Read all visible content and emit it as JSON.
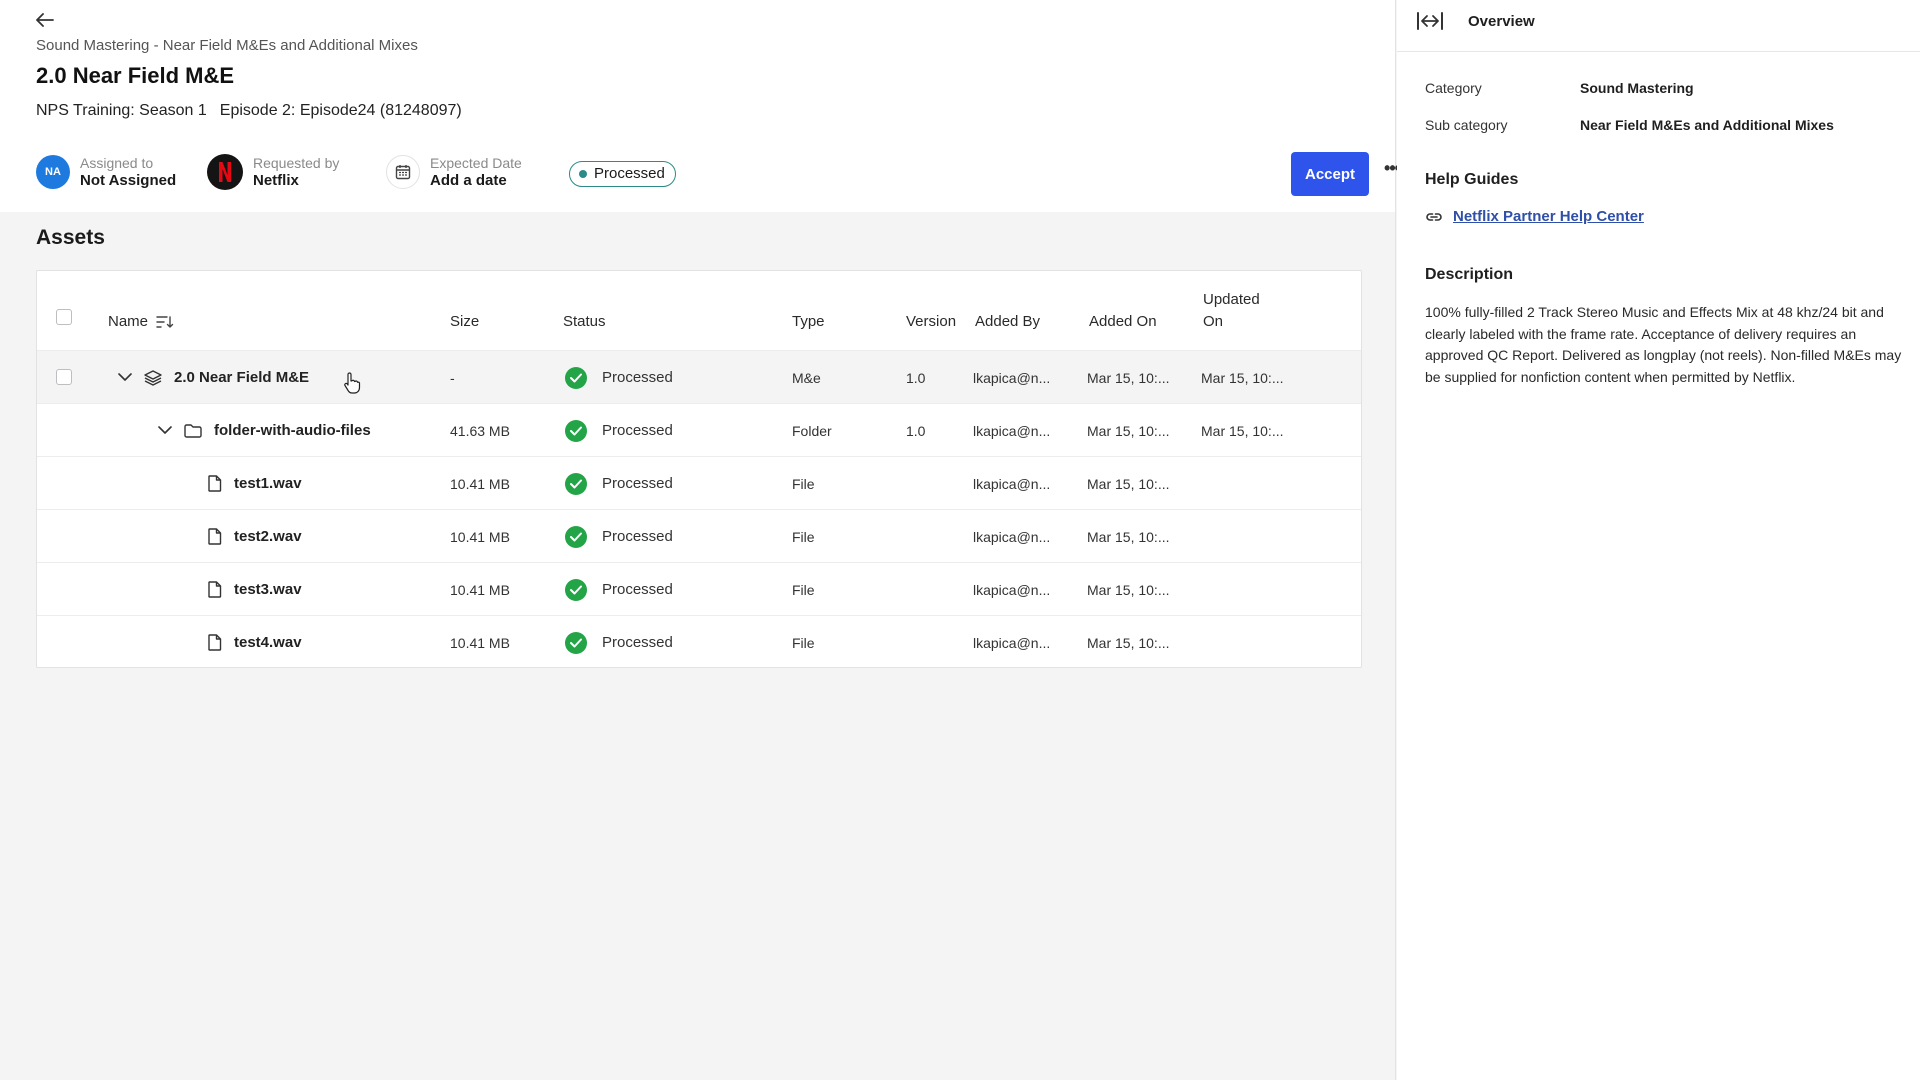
{
  "header": {
    "breadcrumb": "Sound Mastering - Near Field M&Es and Additional Mixes",
    "title": "2.0 Near Field M&E",
    "subtitle_season": "NPS Training: Season 1",
    "subtitle_episode": "Episode 2: Episode24 (81248097)",
    "assigned": {
      "initials": "NA",
      "label": "Assigned to",
      "value": "Not Assigned"
    },
    "requested": {
      "label": "Requested by",
      "value": "Netflix"
    },
    "expected": {
      "label": "Expected Date",
      "value": "Add a date"
    },
    "status": "Processed",
    "accept_label": "Accept",
    "more_label": "•••"
  },
  "assets": {
    "title": "Assets",
    "columns": {
      "name": "Name",
      "size": "Size",
      "status": "Status",
      "type": "Type",
      "version": "Version",
      "added_by": "Added By",
      "added_on": "Added On",
      "updated_on_1": "Updated",
      "updated_on_2": "On"
    },
    "rows": [
      {
        "name": "2.0 Near Field M&E",
        "size": "-",
        "status": "Processed",
        "type": "M&e",
        "version": "1.0",
        "added_by": "lkapica@n...",
        "added_on": "Mar 15, 10:...",
        "updated_on": "Mar 15, 10:..."
      },
      {
        "name": "folder-with-audio-files",
        "size": "41.63 MB",
        "status": "Processed",
        "type": "Folder",
        "version": "1.0",
        "added_by": "lkapica@n...",
        "added_on": "Mar 15, 10:...",
        "updated_on": "Mar 15, 10:..."
      },
      {
        "name": "test1.wav",
        "size": "10.41 MB",
        "status": "Processed",
        "type": "File",
        "version": "",
        "added_by": "lkapica@n...",
        "added_on": "Mar 15, 10:...",
        "updated_on": ""
      },
      {
        "name": "test2.wav",
        "size": "10.41 MB",
        "status": "Processed",
        "type": "File",
        "version": "",
        "added_by": "lkapica@n...",
        "added_on": "Mar 15, 10:...",
        "updated_on": ""
      },
      {
        "name": "test3.wav",
        "size": "10.41 MB",
        "status": "Processed",
        "type": "File",
        "version": "",
        "added_by": "lkapica@n...",
        "added_on": "Mar 15, 10:...",
        "updated_on": ""
      },
      {
        "name": "test4.wav",
        "size": "10.41 MB",
        "status": "Processed",
        "type": "File",
        "version": "",
        "added_by": "lkapica@n...",
        "added_on": "Mar 15, 10:...",
        "updated_on": ""
      }
    ]
  },
  "overview": {
    "title": "Overview",
    "category_label": "Category",
    "category_value": "Sound Mastering",
    "subcategory_label": "Sub category",
    "subcategory_value": "Near Field M&Es and Additional Mixes",
    "help_title": "Help Guides",
    "help_link": "Netflix Partner Help Center",
    "description_title": "Description",
    "description": "100% fully-filled 2 Track Stereo Music and Effects Mix at 48 khz/24 bit and clearly labeled with the frame rate. Acceptance of delivery requires an approved QC Report. Delivered as longplay (not reels). Non-filled M&Es may be supplied for nonfiction content when permitted by Netflix."
  },
  "colors": {
    "accent": "#2f54eb",
    "success": "#22a447",
    "status_pill": "#2c8a8a",
    "link": "#2f4fa8"
  }
}
